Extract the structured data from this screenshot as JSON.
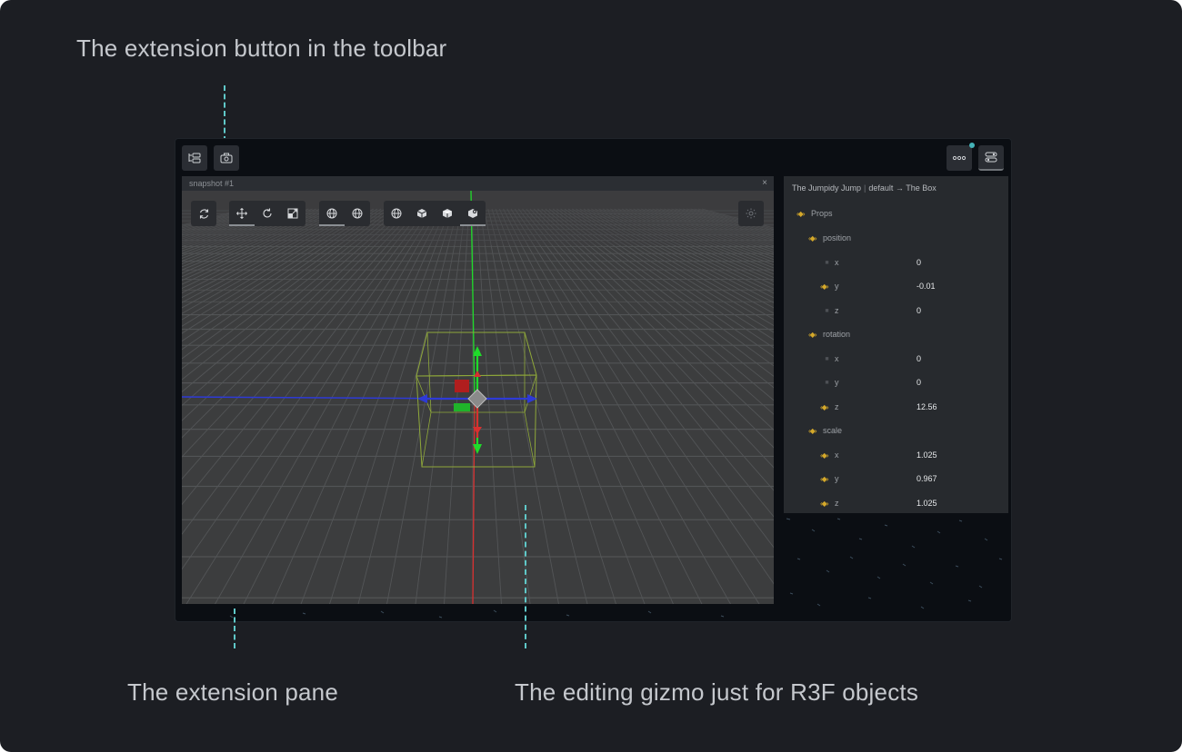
{
  "captions": {
    "toolbar_note": "The extension button in the toolbar",
    "pane_note": "The extension pane",
    "gizmo_note": "The editing gizmo just for R3F objects"
  },
  "toolbar": {
    "left_buttons": [
      "outline-icon",
      "camera-icon"
    ],
    "right_buttons": [
      "more-icon",
      "extension-toggle-icon"
    ]
  },
  "pane": {
    "title": "snapshot #1",
    "close": "×",
    "viewport_tools": {
      "groups": [
        [
          "refresh-icon"
        ],
        [
          "translate-icon",
          "rotate-icon",
          "scale-icon"
        ],
        [
          "globe-world-icon",
          "globe-local-icon"
        ],
        [
          "shading-wire-icon",
          "shading-flat-icon",
          "shading-solid-icon",
          "shading-rendered-icon"
        ]
      ],
      "light_toggle": "sun-icon"
    }
  },
  "props_panel": {
    "breadcrumb": [
      "The Jumpidy Jump",
      "default",
      "→",
      "The Box"
    ],
    "root": "Props",
    "groups": [
      {
        "name": "position",
        "fields": [
          {
            "key": "x",
            "value": "0",
            "keyframed": false
          },
          {
            "key": "y",
            "value": "-0.01",
            "keyframed": true
          },
          {
            "key": "z",
            "value": "0",
            "keyframed": false
          }
        ]
      },
      {
        "name": "rotation",
        "fields": [
          {
            "key": "x",
            "value": "0",
            "keyframed": false
          },
          {
            "key": "y",
            "value": "0",
            "keyframed": false
          },
          {
            "key": "z",
            "value": "12.56",
            "keyframed": true
          }
        ]
      },
      {
        "name": "scale",
        "fields": [
          {
            "key": "x",
            "value": "1.025",
            "keyframed": true
          },
          {
            "key": "y",
            "value": "0.967",
            "keyframed": true
          },
          {
            "key": "z",
            "value": "1.025",
            "keyframed": true
          }
        ]
      }
    ]
  },
  "colors": {
    "frame_bg": "#1c1e23",
    "app_bg": "#0b0e13",
    "viewport_bg": "#3c3d3e",
    "keyframe_accent": "#d4a82a",
    "notify_dot": "#44b3b8",
    "annotation_dash": "#5fc8c8",
    "axis_x": "#2e3ad6",
    "axis_y": "#1fdc2a",
    "axis_z": "#d83030",
    "selection_box": "#8fa83a"
  }
}
